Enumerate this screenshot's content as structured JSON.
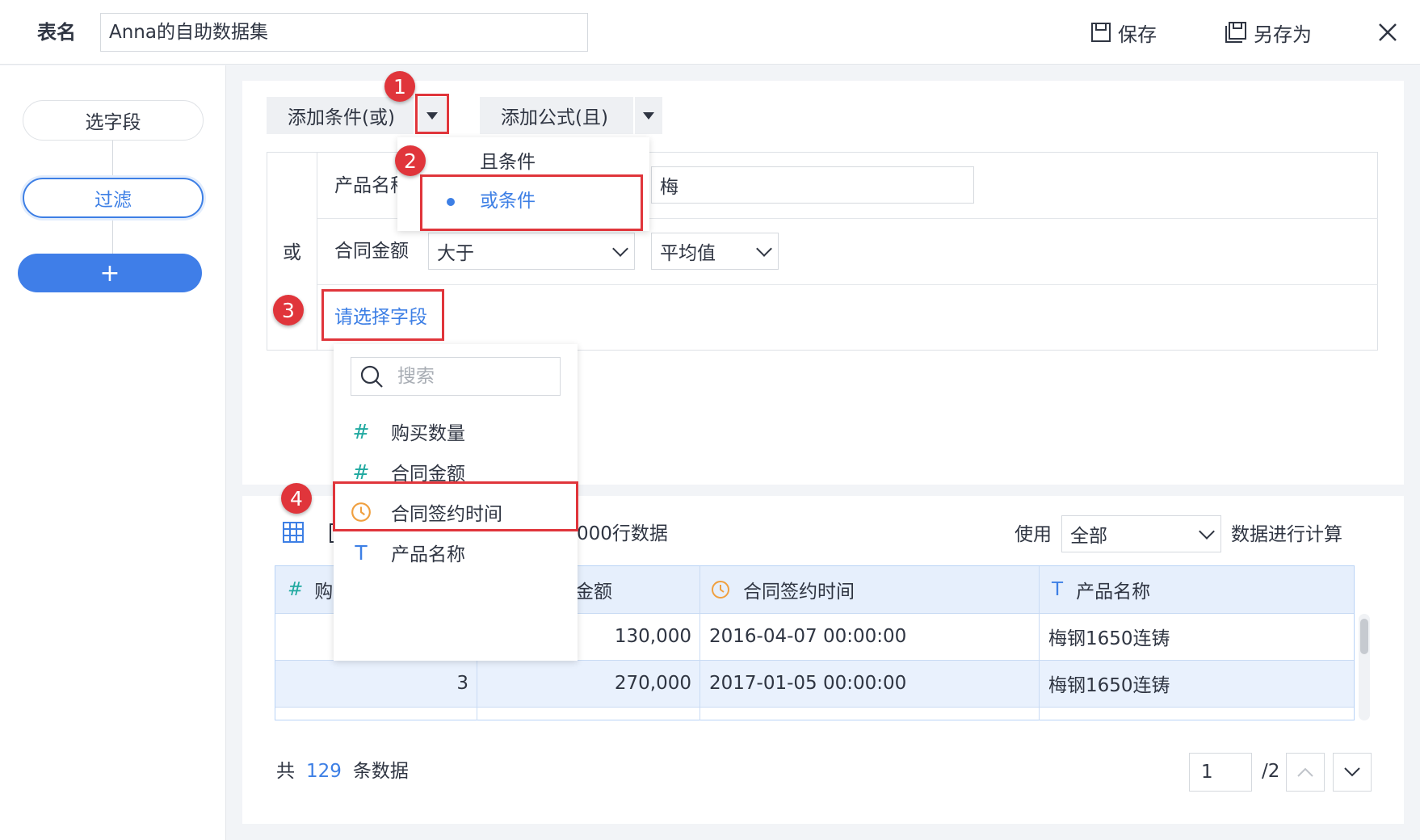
{
  "header": {
    "table_name_label": "表名",
    "table_name_value": "Anna的自助数据集",
    "save_label": "保存",
    "save_as_label": "另存为"
  },
  "steps": {
    "select_fields": "选字段",
    "filter": "过滤",
    "add": "+"
  },
  "filter": {
    "add_condition_label": "添加条件(或)",
    "add_formula_label": "添加公式(且)",
    "group_logic": "或",
    "condition_menu": {
      "and_option": "且条件",
      "or_option": "或条件",
      "selected": "或条件"
    },
    "rows": [
      {
        "field": "产品名称",
        "value": "梅"
      },
      {
        "field": "合同金额",
        "operator": "大于",
        "value": "平均值"
      }
    ],
    "select_field_placeholder": "请选择字段"
  },
  "field_menu": {
    "search_placeholder": "搜索",
    "items": [
      {
        "type_icon": "#",
        "label": "购买数量",
        "icon_name": "number-icon"
      },
      {
        "type_icon": "#",
        "label": "合同金额",
        "icon_name": "number-icon"
      },
      {
        "type_icon": "clock",
        "label": "合同签约时间",
        "icon_name": "date-icon"
      },
      {
        "type_icon": "T",
        "label": "产品名称",
        "icon_name": "text-icon"
      }
    ]
  },
  "data_preview": {
    "rows_text": "000行数据",
    "use_label": "使用",
    "use_value": "全部",
    "calc_label": "数据进行计算",
    "columns": [
      {
        "icon": "#",
        "label": "购"
      },
      {
        "icon": "",
        "label": "金额"
      },
      {
        "icon": "clock",
        "label": "合同签约时间"
      },
      {
        "icon": "T",
        "label": "产品名称"
      }
    ],
    "rows": [
      {
        "c1": "",
        "c2": "130,000",
        "c3": "2016-04-07 00:00:00",
        "c4": "梅钢1650连铸"
      },
      {
        "c1": "3",
        "c2": "270,000",
        "c3": "2017-01-05 00:00:00",
        "c4": "梅钢1650连铸"
      }
    ],
    "total_prefix": "共",
    "total_count": "129",
    "total_suffix": "条数据",
    "page_current": "1",
    "page_total": "/2"
  },
  "annotations": [
    "1",
    "2",
    "3",
    "4"
  ],
  "colors": {
    "accent": "#3d7fe5",
    "highlight": "#e0353b",
    "number_icon": "#20a9a0",
    "date_icon": "#f0a040",
    "text_icon": "#3d7fe5"
  }
}
